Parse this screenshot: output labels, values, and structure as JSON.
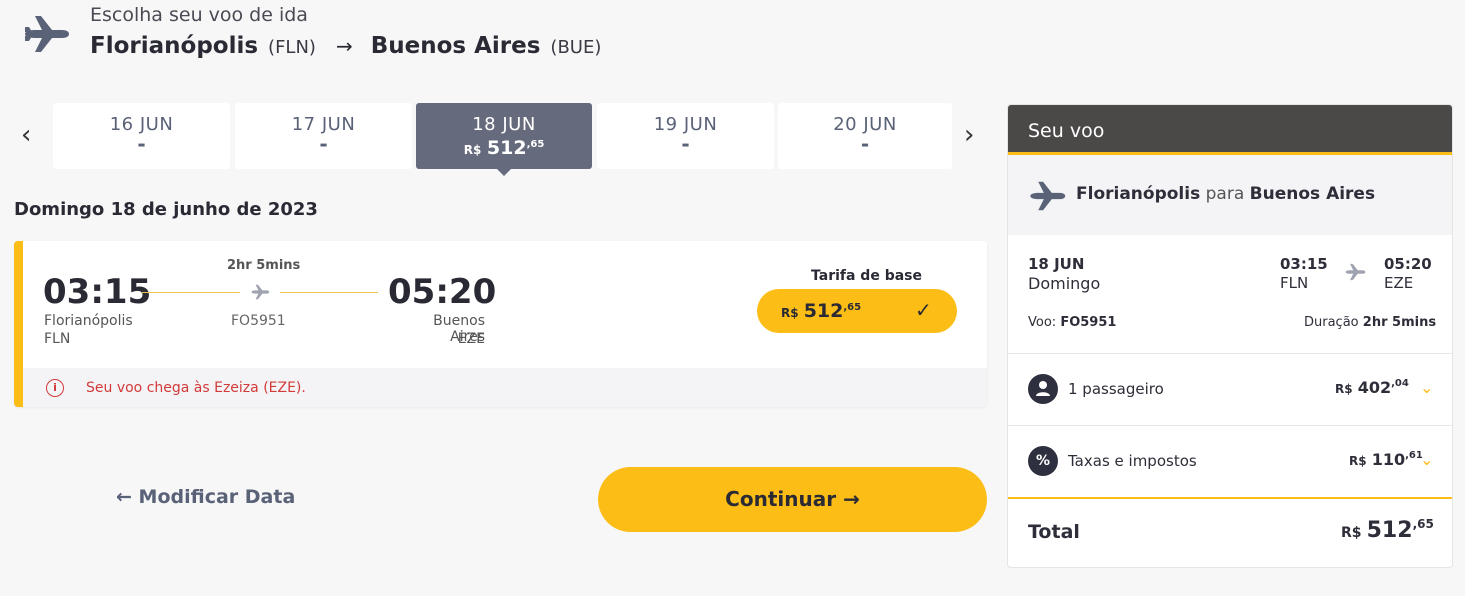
{
  "header": {
    "subtitle": "Escolha seu voo de ida",
    "origin_city": "Florianópolis",
    "origin_code": "(FLN)",
    "destination_city": "Buenos Aires",
    "destination_code": "(BUE)"
  },
  "date_tabs": [
    {
      "date": "16 JUN",
      "price": "-"
    },
    {
      "date": "17 JUN",
      "price": "-"
    },
    {
      "date": "18 JUN",
      "price_currency": "R$",
      "price_int": "512",
      "price_cents": ",65",
      "selected": true
    },
    {
      "date": "19 JUN",
      "price": "-"
    },
    {
      "date": "20 JUN",
      "price": "-"
    }
  ],
  "selected_date_heading": "Domingo 18 de junho de 2023",
  "flight": {
    "depart_time": "03:15",
    "depart_city": "Florianópolis",
    "depart_code": "FLN",
    "duration": "2hr 5mins",
    "flight_number": "FO5951",
    "arrive_time": "05:20",
    "arrive_city": "Buenos Aires",
    "arrive_code": "EZE",
    "fare_label": "Tarifa de base",
    "fare_currency": "R$",
    "fare_int": "512",
    "fare_cents": ",65",
    "warning": "Seu voo chega às Ezeiza (EZE)."
  },
  "actions": {
    "modify": "Modificar Data",
    "continue": "Continuar"
  },
  "summary": {
    "title": "Seu voo",
    "route_from": "Florianópolis",
    "route_connector": "para",
    "route_to": "Buenos Aires",
    "date": "18 JUN",
    "weekday": "Domingo",
    "depart_time": "03:15",
    "depart_code": "FLN",
    "arrive_time": "05:20",
    "arrive_code": "EZE",
    "flight_label": "Voo:",
    "flight_number": "FO5951",
    "duration_label": "Duração",
    "duration": "2hr 5mins",
    "passengers_label": "1 passageiro",
    "passengers_currency": "R$",
    "passengers_int": "402",
    "passengers_cents": ",04",
    "taxes_label": "Taxas e impostos",
    "taxes_currency": "R$",
    "taxes_int": "110",
    "taxes_cents": ",61",
    "total_label": "Total",
    "total_currency": "R$",
    "total_int": "512",
    "total_cents": ",65"
  },
  "colors": {
    "accent": "#fbbd16",
    "selected_tab": "#666a7d",
    "summary_header": "#4b4848",
    "warning": "#d23a3a"
  }
}
